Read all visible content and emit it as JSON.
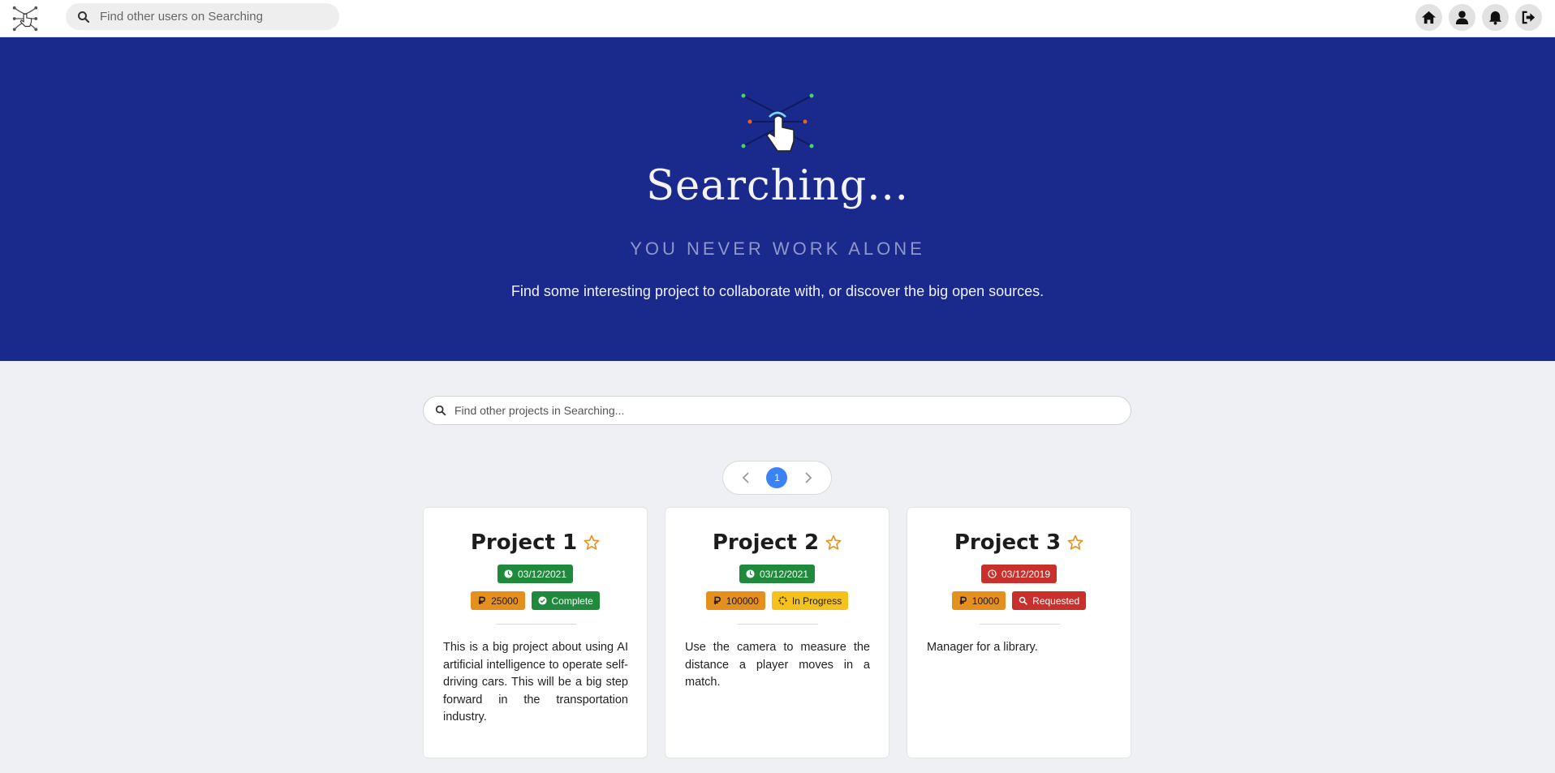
{
  "navbar": {
    "user_search_placeholder": "Find other users on Searching",
    "icons": [
      "home-icon",
      "user-icon",
      "bell-icon",
      "logout-icon"
    ]
  },
  "hero": {
    "title": "Searching...",
    "tagline": "YOU NEVER WORK ALONE",
    "description": "Find some interesting project to collaborate with, or discover the big open sources."
  },
  "projects": {
    "search_placeholder": "Find other projects in Searching...",
    "pagination": {
      "current_page": "1"
    },
    "cards": [
      {
        "title": "Project 1",
        "date": "03/12/2021",
        "date_color": "#1f8a3b",
        "reward": "25000",
        "status": "Complete",
        "status_icon": "check-circle-icon",
        "status_color": "#1f8a3b",
        "description": "This is a big project about using AI artificial intelligence to operate self-driving cars. This will be a big step forward in the transportation industry."
      },
      {
        "title": "Project 2",
        "date": "03/12/2021",
        "date_color": "#1f8a3b",
        "reward": "100000",
        "status": "In Progress",
        "status_icon": "spinner-icon",
        "status_color": "#f4c21b",
        "description": "Use the camera to measure the distance a player moves in a match."
      },
      {
        "title": "Project 3",
        "date": "03/12/2019",
        "date_color": "#c9302c",
        "reward": "10000",
        "status": "Requested",
        "status_icon": "search-icon",
        "status_color": "#c9302c",
        "description": "Manager for a library."
      }
    ]
  },
  "colors": {
    "hero_background": "#1a2a8c",
    "page_background": "#eef0f3",
    "pagination_active": "#3b82f6",
    "reward_badge": "#e58f1f",
    "star": "#e58f1f"
  }
}
